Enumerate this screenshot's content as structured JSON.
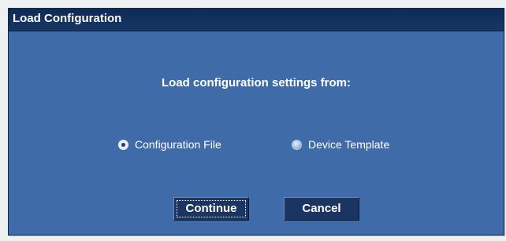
{
  "dialog": {
    "title": "Load Configuration",
    "prompt": "Load configuration settings from:",
    "options": [
      {
        "label": "Configuration File",
        "selected": true
      },
      {
        "label": "Device Template",
        "selected": false
      }
    ],
    "buttons": {
      "continue_label": "Continue",
      "cancel_label": "Cancel"
    }
  },
  "colors": {
    "dialog_background": "#3f6ba8",
    "title_bar": "#0f2a54",
    "button": "#1b3562",
    "text": "#ffffff"
  }
}
